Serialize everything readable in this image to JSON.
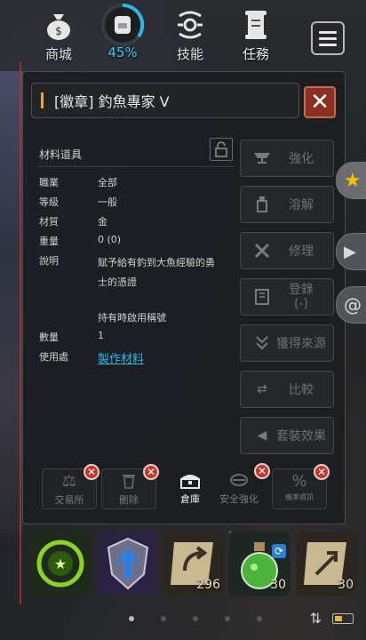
{
  "topbar": {
    "items": [
      {
        "label": "商城",
        "icon": "money-bag-icon"
      },
      {
        "label": "45%",
        "icon": "backpack-icon",
        "progress": 45
      },
      {
        "label": "技能",
        "icon": "skill-icon"
      },
      {
        "label": "任務",
        "icon": "scroll-icon"
      }
    ],
    "menu_icon": "hamburger-menu-icon"
  },
  "panel": {
    "title": "[徽章] 釣魚專家 V",
    "close_icon": "close-icon",
    "info": {
      "header": "材料道具",
      "rows": [
        {
          "key": "職業",
          "value": "全部"
        },
        {
          "key": "等級",
          "value": "一般"
        },
        {
          "key": "材質",
          "value": "金"
        },
        {
          "key": "重量",
          "value": "0 (0)"
        },
        {
          "key": "說明",
          "value": "賦予給有釣到大魚經驗的勇士的憑證"
        },
        {
          "key": "",
          "value": "持有時啟用稱號"
        },
        {
          "key": "數量",
          "value": "1"
        },
        {
          "key": "使用處",
          "value": "製作材料"
        }
      ]
    },
    "actions": [
      {
        "label": "強化",
        "icon": "anvil-icon"
      },
      {
        "label": "溶解",
        "icon": "potion-bottle-icon"
      },
      {
        "label": "修理",
        "icon": "tools-icon"
      },
      {
        "label": "登錄\n(-)",
        "label1": "登錄",
        "label2": "(-)",
        "icon": "book-icon"
      },
      {
        "label": "獲得來源",
        "icon": "source-icon"
      },
      {
        "label": "比較",
        "icon": "compare-arrows-icon"
      },
      {
        "label": "套裝效果",
        "icon": "triangle-left-icon"
      }
    ],
    "tools": [
      {
        "label": "交易所",
        "icon": "scales-icon",
        "disabled": true
      },
      {
        "label": "刪除",
        "icon": "trash-icon",
        "disabled": true
      },
      {
        "label": "倉庫",
        "icon": "chest-icon",
        "disabled": false
      },
      {
        "label": "安全強化",
        "icon": "safe-enhance-icon",
        "disabled": true
      },
      {
        "label": "機率資訊",
        "icon": "percent-icon",
        "disabled": true
      }
    ]
  },
  "quickbar": {
    "slots": [
      {
        "icon": "green-star-emblem-icon",
        "qty": ""
      },
      {
        "icon": "blue-shield-up-icon",
        "qty": ""
      },
      {
        "icon": "scroll-return-icon",
        "qty": "296"
      },
      {
        "icon": "green-potion-icon",
        "qty": "30"
      },
      {
        "icon": "scroll-arrow-icon",
        "qty": "30"
      }
    ],
    "page_count": 5,
    "page_active": 0
  },
  "colors": {
    "accent_blue": "#2fb6e8",
    "title_accent": "#e4a24e",
    "close_red": "#8a2f22",
    "badge_red": "#c0392b"
  }
}
